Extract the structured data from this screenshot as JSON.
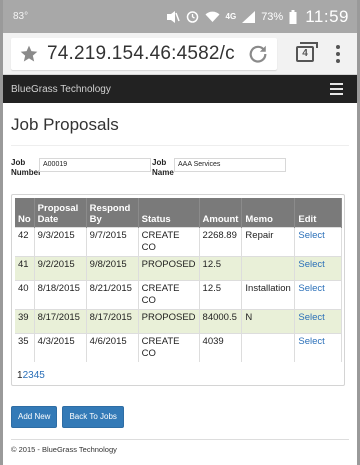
{
  "statusbar": {
    "temperature": "83°",
    "signal_label": "4G",
    "battery": "73%",
    "time": "11:59"
  },
  "browser": {
    "url": "74.219.154.46:4582/c",
    "tab_count": "4",
    "icons": [
      "star-icon",
      "reload-icon",
      "tabs-icon",
      "overflow-menu-icon"
    ]
  },
  "navbar": {
    "brand": "BlueGrass Technology",
    "icons": [
      "hamburger-icon"
    ]
  },
  "page": {
    "title": "Job Proposals"
  },
  "form": {
    "job_number_label_1": "Job",
    "job_number_label_2": "Number",
    "job_number_value": "A00019",
    "job_name_label_1": "Job",
    "job_name_label_2": "Name",
    "job_name_value": "AAA Services"
  },
  "table": {
    "headers": {
      "no": "No",
      "proposal_date_1": "Proposal",
      "proposal_date_2": "Date",
      "respond_by_1": "Respond",
      "respond_by_2": "By",
      "status": "Status",
      "amount": "Amount",
      "memo": "Memo",
      "edit": "Edit"
    },
    "rows": [
      {
        "no": "42",
        "proposal_date": "9/3/2015",
        "respond_by": "9/7/2015",
        "status_1": "CREATE",
        "status_2": "CO",
        "amount": "2268.89",
        "memo": "Repair",
        "edit": "Select"
      },
      {
        "no": "41",
        "proposal_date": "9/2/2015",
        "respond_by": "9/8/2015",
        "status_1": "PROPOSED",
        "status_2": "",
        "amount": "12.5",
        "memo": "",
        "edit": "Select"
      },
      {
        "no": "40",
        "proposal_date": "8/18/2015",
        "respond_by": "8/21/2015",
        "status_1": "CREATE",
        "status_2": "CO",
        "amount": "12.5",
        "memo": "Installation",
        "edit": "Select"
      },
      {
        "no": "39",
        "proposal_date": "8/17/2015",
        "respond_by": "8/17/2015",
        "status_1": "PROPOSED",
        "status_2": "",
        "amount": "84000.5",
        "memo": "N",
        "edit": "Select"
      },
      {
        "no": "35",
        "proposal_date": "4/3/2015",
        "respond_by": "4/6/2015",
        "status_1": "CREATE",
        "status_2": "CO",
        "amount": "4039",
        "memo": "",
        "edit": "Select"
      }
    ]
  },
  "pager": {
    "current": "1",
    "pages": [
      "2",
      "3",
      "4",
      "5"
    ]
  },
  "actions": {
    "add_new": "Add New",
    "back_to_jobs": "Back To Jobs"
  },
  "footer": {
    "text": "© 2015 - BlueGrass Technology"
  },
  "colors": {
    "navbar_bg": "#222222",
    "table_header_bg": "#7a7a7a",
    "alt_row_bg": "#e9f0d8",
    "link": "#2a6fb8",
    "button_bg": "#337ab7"
  }
}
